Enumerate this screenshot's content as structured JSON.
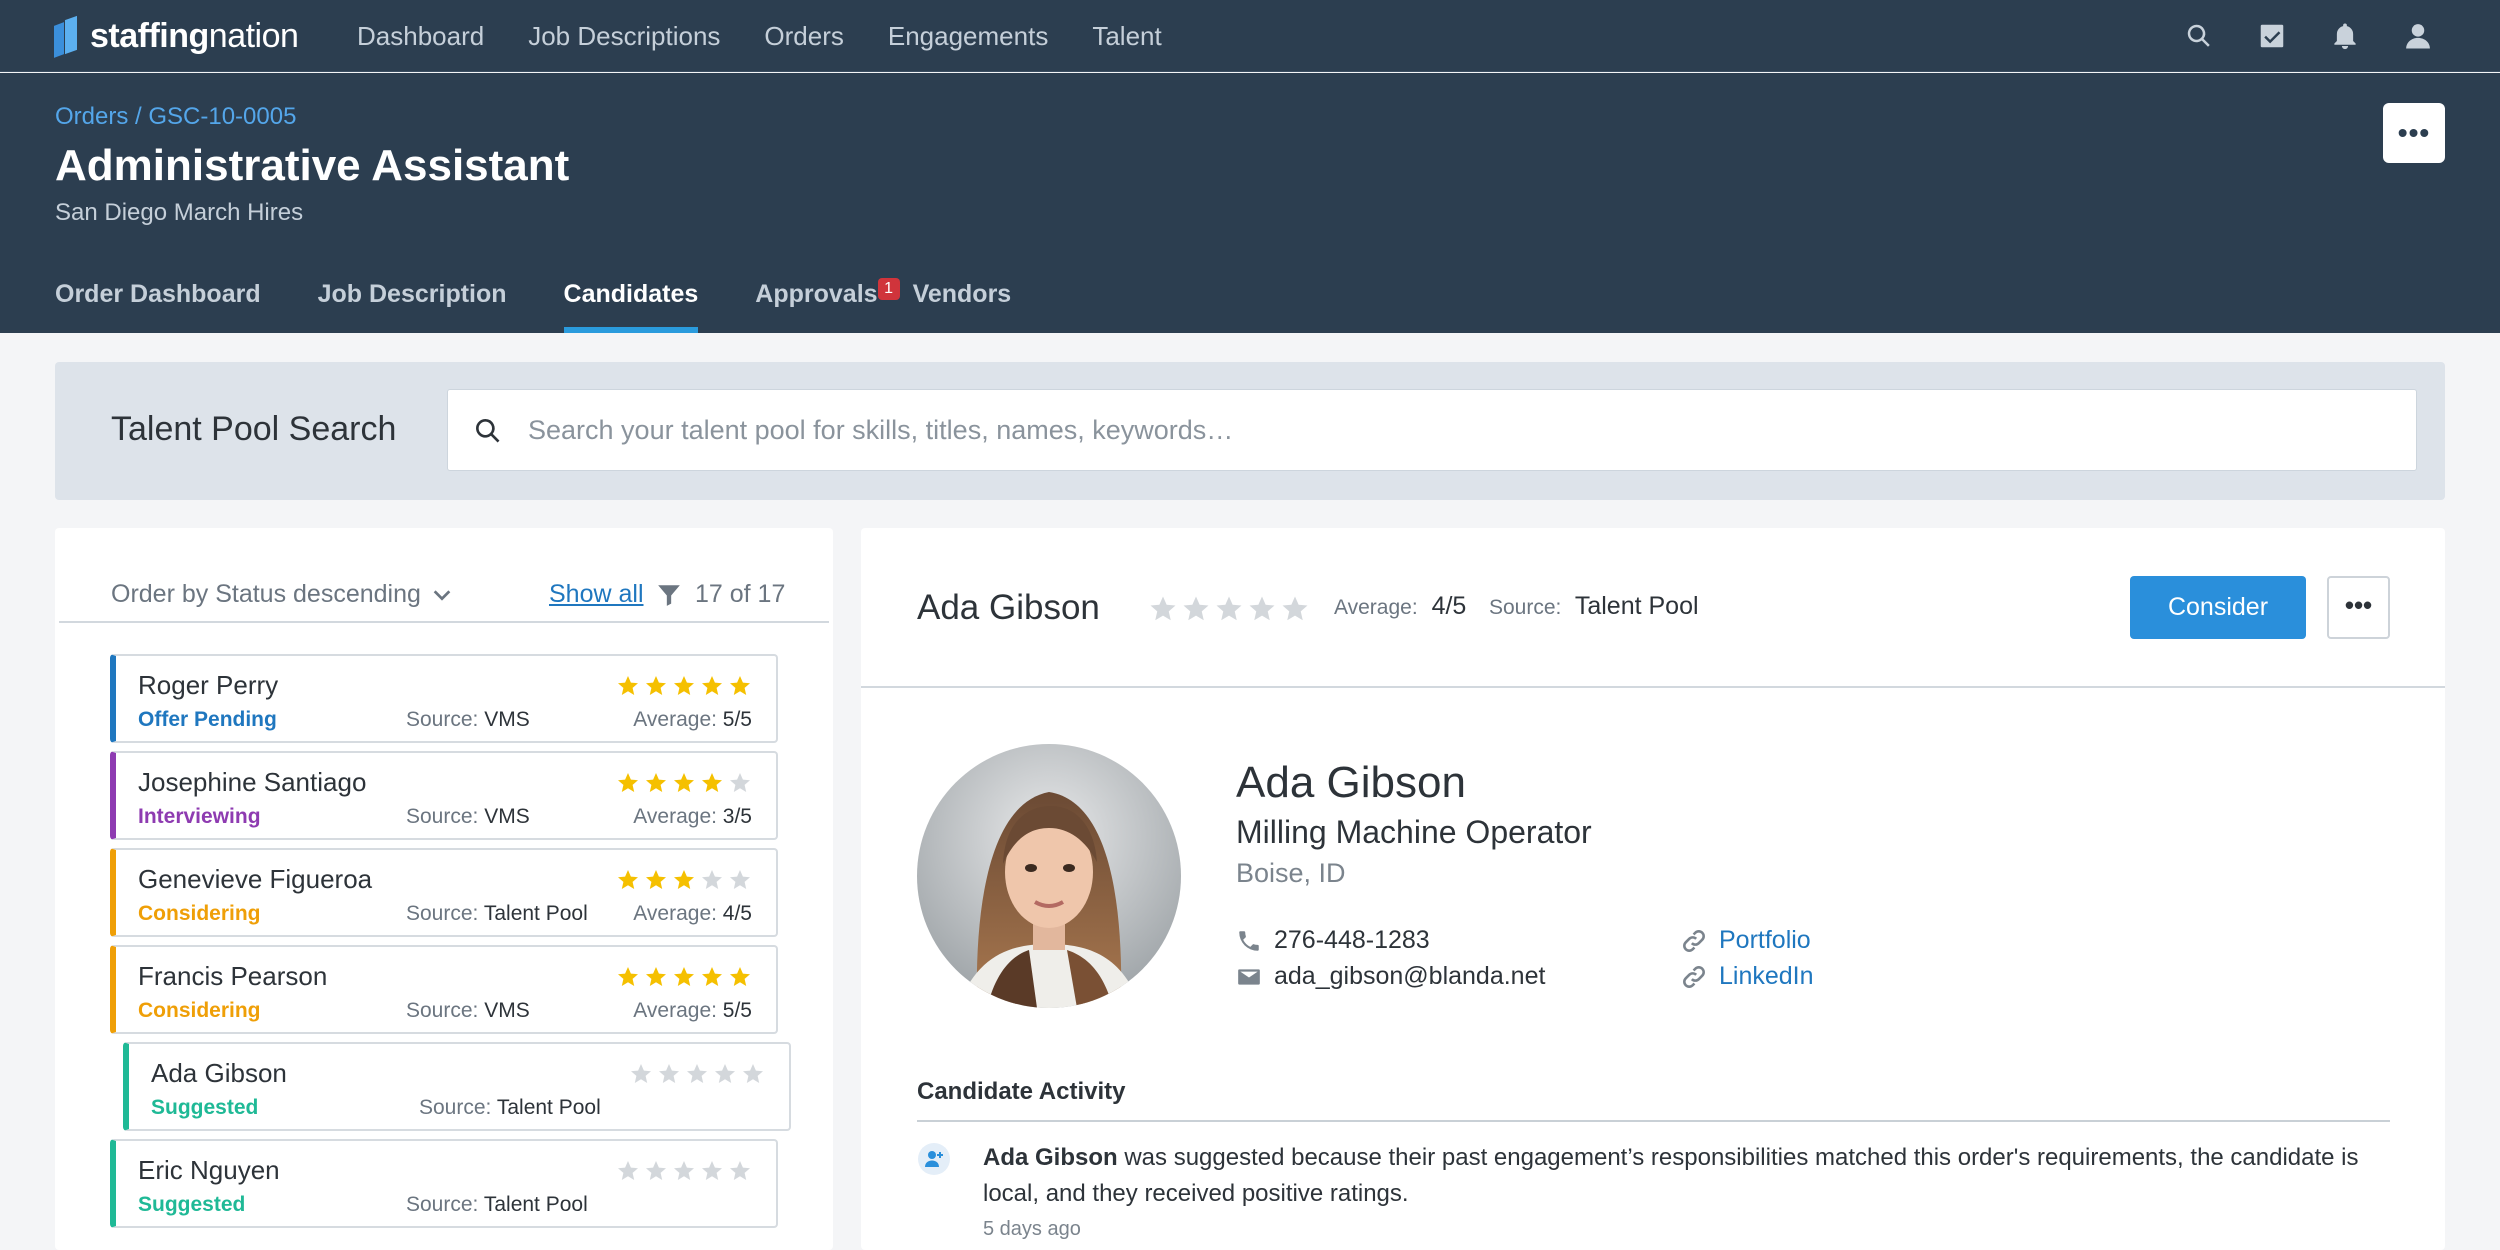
{
  "nav": {
    "logo_bold": "staffing",
    "logo_light": "nation",
    "links": [
      "Dashboard",
      "Job Descriptions",
      "Orders",
      "Engagements",
      "Talent"
    ],
    "icons": [
      "search-icon",
      "tasks-check-icon",
      "bell-icon",
      "user-icon"
    ]
  },
  "header": {
    "breadcrumb": "Orders / GSC-10-0005",
    "title": "Administrative Assistant",
    "subtitle": "San Diego March Hires",
    "more_label": "•••",
    "tabs": [
      {
        "label": "Order Dashboard"
      },
      {
        "label": "Job Description"
      },
      {
        "label": "Candidates",
        "active": true
      },
      {
        "label": "Approvals",
        "badge": "1"
      },
      {
        "label": "Vendors"
      }
    ]
  },
  "search": {
    "title": "Talent Pool Search",
    "placeholder": "Search your talent pool for skills, titles, names, keywords…"
  },
  "list": {
    "order_label": "Order by Status descending",
    "show_all": "Show all",
    "count": "17 of 17",
    "source_label": "Source:",
    "average_label": "Average:",
    "candidates": [
      {
        "name": "Roger Perry",
        "status": "Offer Pending",
        "source": "VMS",
        "average": "5/5",
        "rating": 5
      },
      {
        "name": "Josephine Santiago",
        "status": "Interviewing",
        "source": "VMS",
        "average": "3/5",
        "rating": 4
      },
      {
        "name": "Genevieve Figueroa",
        "status": "Considering",
        "source": "Talent Pool",
        "average": "4/5",
        "rating": 3
      },
      {
        "name": "Francis Pearson",
        "status": "Considering",
        "source": "VMS",
        "average": "5/5",
        "rating": 5
      },
      {
        "name": "Ada Gibson",
        "status": "Suggested",
        "source": "Talent Pool",
        "average": "",
        "rating": 0
      },
      {
        "name": "Eric Nguyen",
        "status": "Suggested",
        "source": "Talent Pool",
        "average": "",
        "rating": 0
      }
    ]
  },
  "detail": {
    "name": "Ada Gibson",
    "rating": 0,
    "average_label": "Average:",
    "average": "4/5",
    "source_label": "Source:",
    "source": "Talent Pool",
    "consider_label": "Consider",
    "more_label": "•••",
    "profile": {
      "name": "Ada Gibson",
      "title": "Milling Machine Operator",
      "location": "Boise, ID",
      "phone": "276-448-1283",
      "email": "ada_gibson@blanda.net",
      "portfolio": "Portfolio",
      "linkedin": "LinkedIn"
    },
    "activity": {
      "title": "Candidate Activity",
      "entry_name": "Ada Gibson",
      "entry_text": " was suggested because their past engagement’s responsibilities matched this order's requirements, the candidate is local, and they received positive ratings.",
      "entry_time": "5 days ago"
    }
  },
  "colors": {
    "nav_bg": "#2c3e50",
    "accent": "#2a8fdb",
    "offer_pending": "#1f77bf",
    "interviewing": "#8e3bb1",
    "considering": "#ef9f07",
    "suggested": "#1fb996",
    "star": "#f5c000"
  }
}
